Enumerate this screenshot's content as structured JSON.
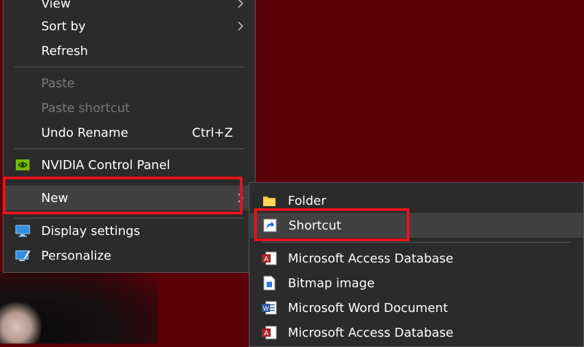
{
  "main_menu": {
    "items": [
      {
        "label": "View"
      },
      {
        "label": "Sort by"
      },
      {
        "label": "Refresh"
      },
      {
        "label": "Paste"
      },
      {
        "label": "Paste shortcut"
      },
      {
        "label": "Undo Rename",
        "shortcut": "Ctrl+Z"
      },
      {
        "label": "NVIDIA Control Panel",
        "icon": "nvidia-icon"
      },
      {
        "label": "New"
      },
      {
        "label": "Display settings",
        "icon": "display-icon"
      },
      {
        "label": "Personalize",
        "icon": "personalize-icon"
      }
    ]
  },
  "new_submenu": {
    "items": [
      {
        "label": "Folder",
        "icon": "folder-icon"
      },
      {
        "label": "Shortcut",
        "icon": "shortcut-icon"
      },
      {
        "label": "Microsoft Access Database",
        "icon": "access-icon"
      },
      {
        "label": "Bitmap image",
        "icon": "bitmap-icon"
      },
      {
        "label": "Microsoft Word Document",
        "icon": "word-icon"
      },
      {
        "label": "Microsoft Access Database",
        "icon": "access-icon"
      }
    ]
  },
  "colors": {
    "menu_bg": "#2b2b2b",
    "highlight": "#414141",
    "annotation_red": "#e4141c",
    "desktop_bg": "#5c0008"
  }
}
